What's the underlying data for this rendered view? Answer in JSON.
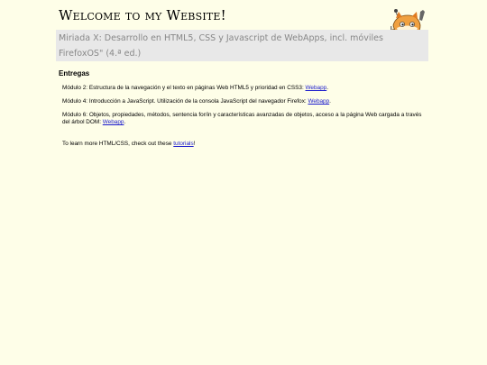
{
  "header": {
    "title": "Welcome to my Website!",
    "subtitle": "Miriada X: Desarrollo en HTML5, CSS y Javascript de WebApps, incl. móviles FirefoxOS\" (4.ª ed.)"
  },
  "mascot": {
    "icon": "firefox-os-mascot-icon"
  },
  "main": {
    "heading": "Entregas",
    "items": [
      {
        "text": "Módulo 2: Estructura de la navegación y el texto en páginas Web HTML5 y prioridad en CSS3:",
        "link": "Webapp",
        "suffix": "."
      },
      {
        "text": "Módulo 4: Introducción a JavaScript. Utilización de la consola JavaScript del navegador Firefox:",
        "link": "Webapp",
        "suffix": "."
      },
      {
        "text": "Módulo 6: Objetos, propiedades, métodos, sentencia for/in y características avanzadas de objetos, acceso a la página Web cargada a través del árbol DOM:",
        "link": "Webapp",
        "suffix": "."
      }
    ],
    "learn_more": {
      "text": "To learn more HTML/CSS, check out these",
      "link": "tutorials",
      "suffix": "!"
    }
  },
  "colors": {
    "background": "#fefee8",
    "subtitle_bg": "#e8e8e8",
    "subtitle_text": "#888888",
    "link": "#1a1acc"
  }
}
